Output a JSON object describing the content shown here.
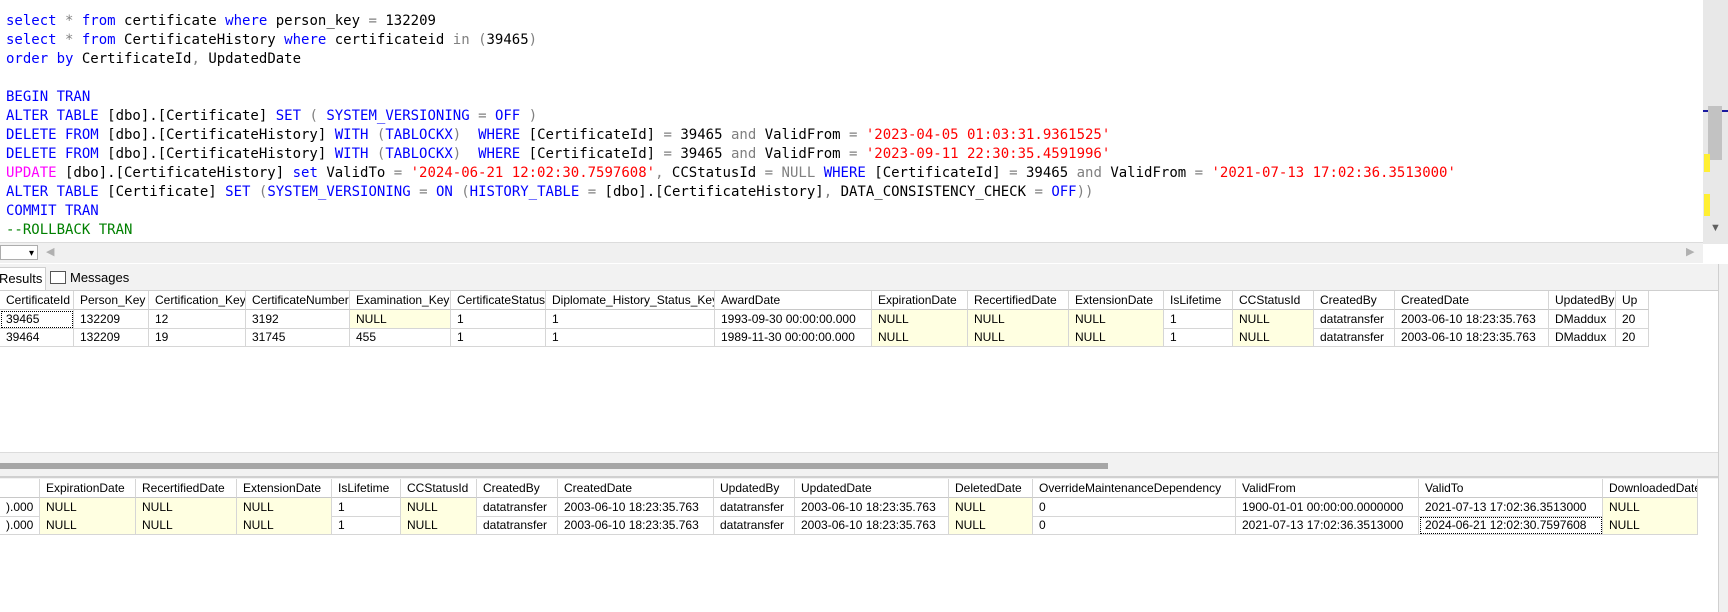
{
  "editor": {
    "lines": [
      [
        [
          "kw",
          "select"
        ],
        [
          "op",
          " * "
        ],
        [
          "kw",
          "from"
        ],
        [
          "tx",
          " certificate "
        ],
        [
          "kw",
          "where"
        ],
        [
          "tx",
          " person_key "
        ],
        [
          "op",
          "="
        ],
        [
          "tx",
          " 132209"
        ]
      ],
      [
        [
          "kw",
          "select"
        ],
        [
          "op",
          " * "
        ],
        [
          "kw",
          "from"
        ],
        [
          "tx",
          " CertificateHistory "
        ],
        [
          "kw",
          "where"
        ],
        [
          "tx",
          " certificateid "
        ],
        [
          "op",
          "in"
        ],
        [
          "tx",
          " "
        ],
        [
          "op",
          "("
        ],
        [
          "tx",
          "39465"
        ],
        [
          "op",
          ")"
        ]
      ],
      [
        [
          "kw",
          "order by"
        ],
        [
          "tx",
          " CertificateId"
        ],
        [
          "op",
          ","
        ],
        [
          "tx",
          " UpdatedDate"
        ]
      ],
      [],
      [
        [
          "kw",
          "BEGIN TRAN"
        ]
      ],
      [
        [
          "kw",
          "ALTER TABLE"
        ],
        [
          "tx",
          " [dbo].[Certificate] "
        ],
        [
          "kw",
          "SET"
        ],
        [
          "tx",
          " "
        ],
        [
          "op",
          "("
        ],
        [
          "tx",
          " "
        ],
        [
          "kw",
          "SYSTEM_VERSIONING"
        ],
        [
          "tx",
          " "
        ],
        [
          "op",
          "="
        ],
        [
          "tx",
          " "
        ],
        [
          "kw",
          "OFF"
        ],
        [
          "tx",
          " "
        ],
        [
          "op",
          ")"
        ]
      ],
      [
        [
          "kw",
          "DELETE FROM"
        ],
        [
          "tx",
          " [dbo].[CertificateHistory] "
        ],
        [
          "kw",
          "WITH"
        ],
        [
          "tx",
          " "
        ],
        [
          "op",
          "("
        ],
        [
          "kw",
          "TABLOCKX"
        ],
        [
          "op",
          ")"
        ],
        [
          "tx",
          "  "
        ],
        [
          "kw",
          "WHERE"
        ],
        [
          "tx",
          " [CertificateId] "
        ],
        [
          "op",
          "="
        ],
        [
          "tx",
          " 39465 "
        ],
        [
          "op",
          "and"
        ],
        [
          "tx",
          " ValidFrom "
        ],
        [
          "op",
          "="
        ],
        [
          "tx",
          " "
        ],
        [
          "str",
          "'2023-04-05 01:03:31.9361525'"
        ]
      ],
      [
        [
          "kw",
          "DELETE FROM"
        ],
        [
          "tx",
          " [dbo].[CertificateHistory] "
        ],
        [
          "kw",
          "WITH"
        ],
        [
          "tx",
          " "
        ],
        [
          "op",
          "("
        ],
        [
          "kw",
          "TABLOCKX"
        ],
        [
          "op",
          ")"
        ],
        [
          "tx",
          "  "
        ],
        [
          "kw",
          "WHERE"
        ],
        [
          "tx",
          " [CertificateId] "
        ],
        [
          "op",
          "="
        ],
        [
          "tx",
          " 39465 "
        ],
        [
          "op",
          "and"
        ],
        [
          "tx",
          " ValidFrom "
        ],
        [
          "op",
          "="
        ],
        [
          "tx",
          " "
        ],
        [
          "str",
          "'2023-09-11 22:30:35.4591996'"
        ]
      ],
      [
        [
          "fn",
          "UPDATE"
        ],
        [
          "tx",
          " [dbo].[CertificateHistory] "
        ],
        [
          "kw",
          "set"
        ],
        [
          "tx",
          " ValidTo "
        ],
        [
          "op",
          "="
        ],
        [
          "tx",
          " "
        ],
        [
          "str",
          "'2024-06-21 12:02:30.7597608'"
        ],
        [
          "op",
          ","
        ],
        [
          "tx",
          " CCStatusId "
        ],
        [
          "op",
          "="
        ],
        [
          "tx",
          " "
        ],
        [
          "op",
          "NULL"
        ],
        [
          "tx",
          " "
        ],
        [
          "kw",
          "WHERE"
        ],
        [
          "tx",
          " [CertificateId] "
        ],
        [
          "op",
          "="
        ],
        [
          "tx",
          " 39465 "
        ],
        [
          "op",
          "and"
        ],
        [
          "tx",
          " ValidFrom "
        ],
        [
          "op",
          "="
        ],
        [
          "tx",
          " "
        ],
        [
          "str",
          "'2021-07-13 17:02:36.3513000'"
        ]
      ],
      [
        [
          "kw",
          "ALTER TABLE"
        ],
        [
          "tx",
          " [Certificate] "
        ],
        [
          "kw",
          "SET"
        ],
        [
          "tx",
          " "
        ],
        [
          "op",
          "("
        ],
        [
          "kw",
          "SYSTEM_VERSIONING"
        ],
        [
          "tx",
          " "
        ],
        [
          "op",
          "="
        ],
        [
          "tx",
          " "
        ],
        [
          "kw",
          "ON"
        ],
        [
          "tx",
          " "
        ],
        [
          "op",
          "("
        ],
        [
          "kw",
          "HISTORY_TABLE"
        ],
        [
          "tx",
          " "
        ],
        [
          "op",
          "="
        ],
        [
          "tx",
          " [dbo].[CertificateHistory]"
        ],
        [
          "op",
          ","
        ],
        [
          "tx",
          " DATA_CONSISTENCY_CHECK "
        ],
        [
          "op",
          "="
        ],
        [
          "tx",
          " "
        ],
        [
          "kw",
          "OFF"
        ],
        [
          "op",
          "))"
        ]
      ],
      [
        [
          "kw",
          "COMMIT TRAN"
        ]
      ],
      [
        [
          "cm",
          "--ROLLBACK TRAN"
        ]
      ]
    ]
  },
  "tabs": {
    "results": "Results",
    "messages": "Messages"
  },
  "grid1": {
    "columns": [
      {
        "name": "CertificateId",
        "w": 74
      },
      {
        "name": "Person_Key",
        "w": 75
      },
      {
        "name": "Certification_Key",
        "w": 97
      },
      {
        "name": "CertificateNumber",
        "w": 104
      },
      {
        "name": "Examination_Key",
        "w": 101
      },
      {
        "name": "CertificateStatus",
        "w": 95
      },
      {
        "name": "Diplomate_History_Status_Key",
        "w": 169
      },
      {
        "name": "AwardDate",
        "w": 157
      },
      {
        "name": "ExpirationDate",
        "w": 96
      },
      {
        "name": "RecertifiedDate",
        "w": 101
      },
      {
        "name": "ExtensionDate",
        "w": 95
      },
      {
        "name": "IsLifetime",
        "w": 69
      },
      {
        "name": "CCStatusId",
        "w": 81
      },
      {
        "name": "CreatedBy",
        "w": 81
      },
      {
        "name": "CreatedDate",
        "w": 154
      },
      {
        "name": "UpdatedBy",
        "w": 67
      },
      {
        "name": "Up",
        "w": 33
      }
    ],
    "rows": [
      [
        "39465",
        "132209",
        "12",
        "3192",
        "NULL",
        "1",
        "1",
        "1993-09-30 00:00:00.000",
        "NULL",
        "NULL",
        "NULL",
        "1",
        "NULL",
        "datatransfer",
        "2003-06-10 18:23:35.763",
        "DMaddux",
        "20"
      ],
      [
        "39464",
        "132209",
        "19",
        "31745",
        "455",
        "1",
        "1",
        "1989-11-30 00:00:00.000",
        "NULL",
        "NULL",
        "NULL",
        "1",
        "NULL",
        "datatransfer",
        "2003-06-10 18:23:35.763",
        "DMaddux",
        "20"
      ]
    ]
  },
  "grid2": {
    "columns": [
      {
        "name": "",
        "w": 40
      },
      {
        "name": "ExpirationDate",
        "w": 96
      },
      {
        "name": "RecertifiedDate",
        "w": 101
      },
      {
        "name": "ExtensionDate",
        "w": 95
      },
      {
        "name": "IsLifetime",
        "w": 69
      },
      {
        "name": "CCStatusId",
        "w": 76
      },
      {
        "name": "CreatedBy",
        "w": 81
      },
      {
        "name": "CreatedDate",
        "w": 156
      },
      {
        "name": "UpdatedBy",
        "w": 81
      },
      {
        "name": "UpdatedDate",
        "w": 154
      },
      {
        "name": "DeletedDate",
        "w": 84
      },
      {
        "name": "OverrideMaintenanceDependency",
        "w": 203
      },
      {
        "name": "ValidFrom",
        "w": 183
      },
      {
        "name": "ValidTo",
        "w": 184
      },
      {
        "name": "DownloadedDate",
        "w": 95
      }
    ],
    "rows": [
      [
        ").000",
        "NULL",
        "NULL",
        "NULL",
        "1",
        "NULL",
        "datatransfer",
        "2003-06-10 18:23:35.763",
        "datatransfer",
        "2003-06-10 18:23:35.763",
        "NULL",
        "0",
        "1900-01-01 00:00:00.0000000",
        "2021-07-13 17:02:36.3513000",
        "NULL"
      ],
      [
        ").000",
        "NULL",
        "NULL",
        "NULL",
        "1",
        "NULL",
        "datatransfer",
        "2003-06-10 18:23:35.763",
        "datatransfer",
        "2003-06-10 18:23:35.763",
        "NULL",
        "0",
        "2021-07-13 17:02:36.3513000",
        "2024-06-21 12:02:30.7597608",
        "NULL"
      ]
    ]
  },
  "colors": {
    "keyword": "#0000ff",
    "string": "#ff0000",
    "function": "#ff00ff",
    "comment": "#008000",
    "null_cell": "#ffffe1"
  }
}
